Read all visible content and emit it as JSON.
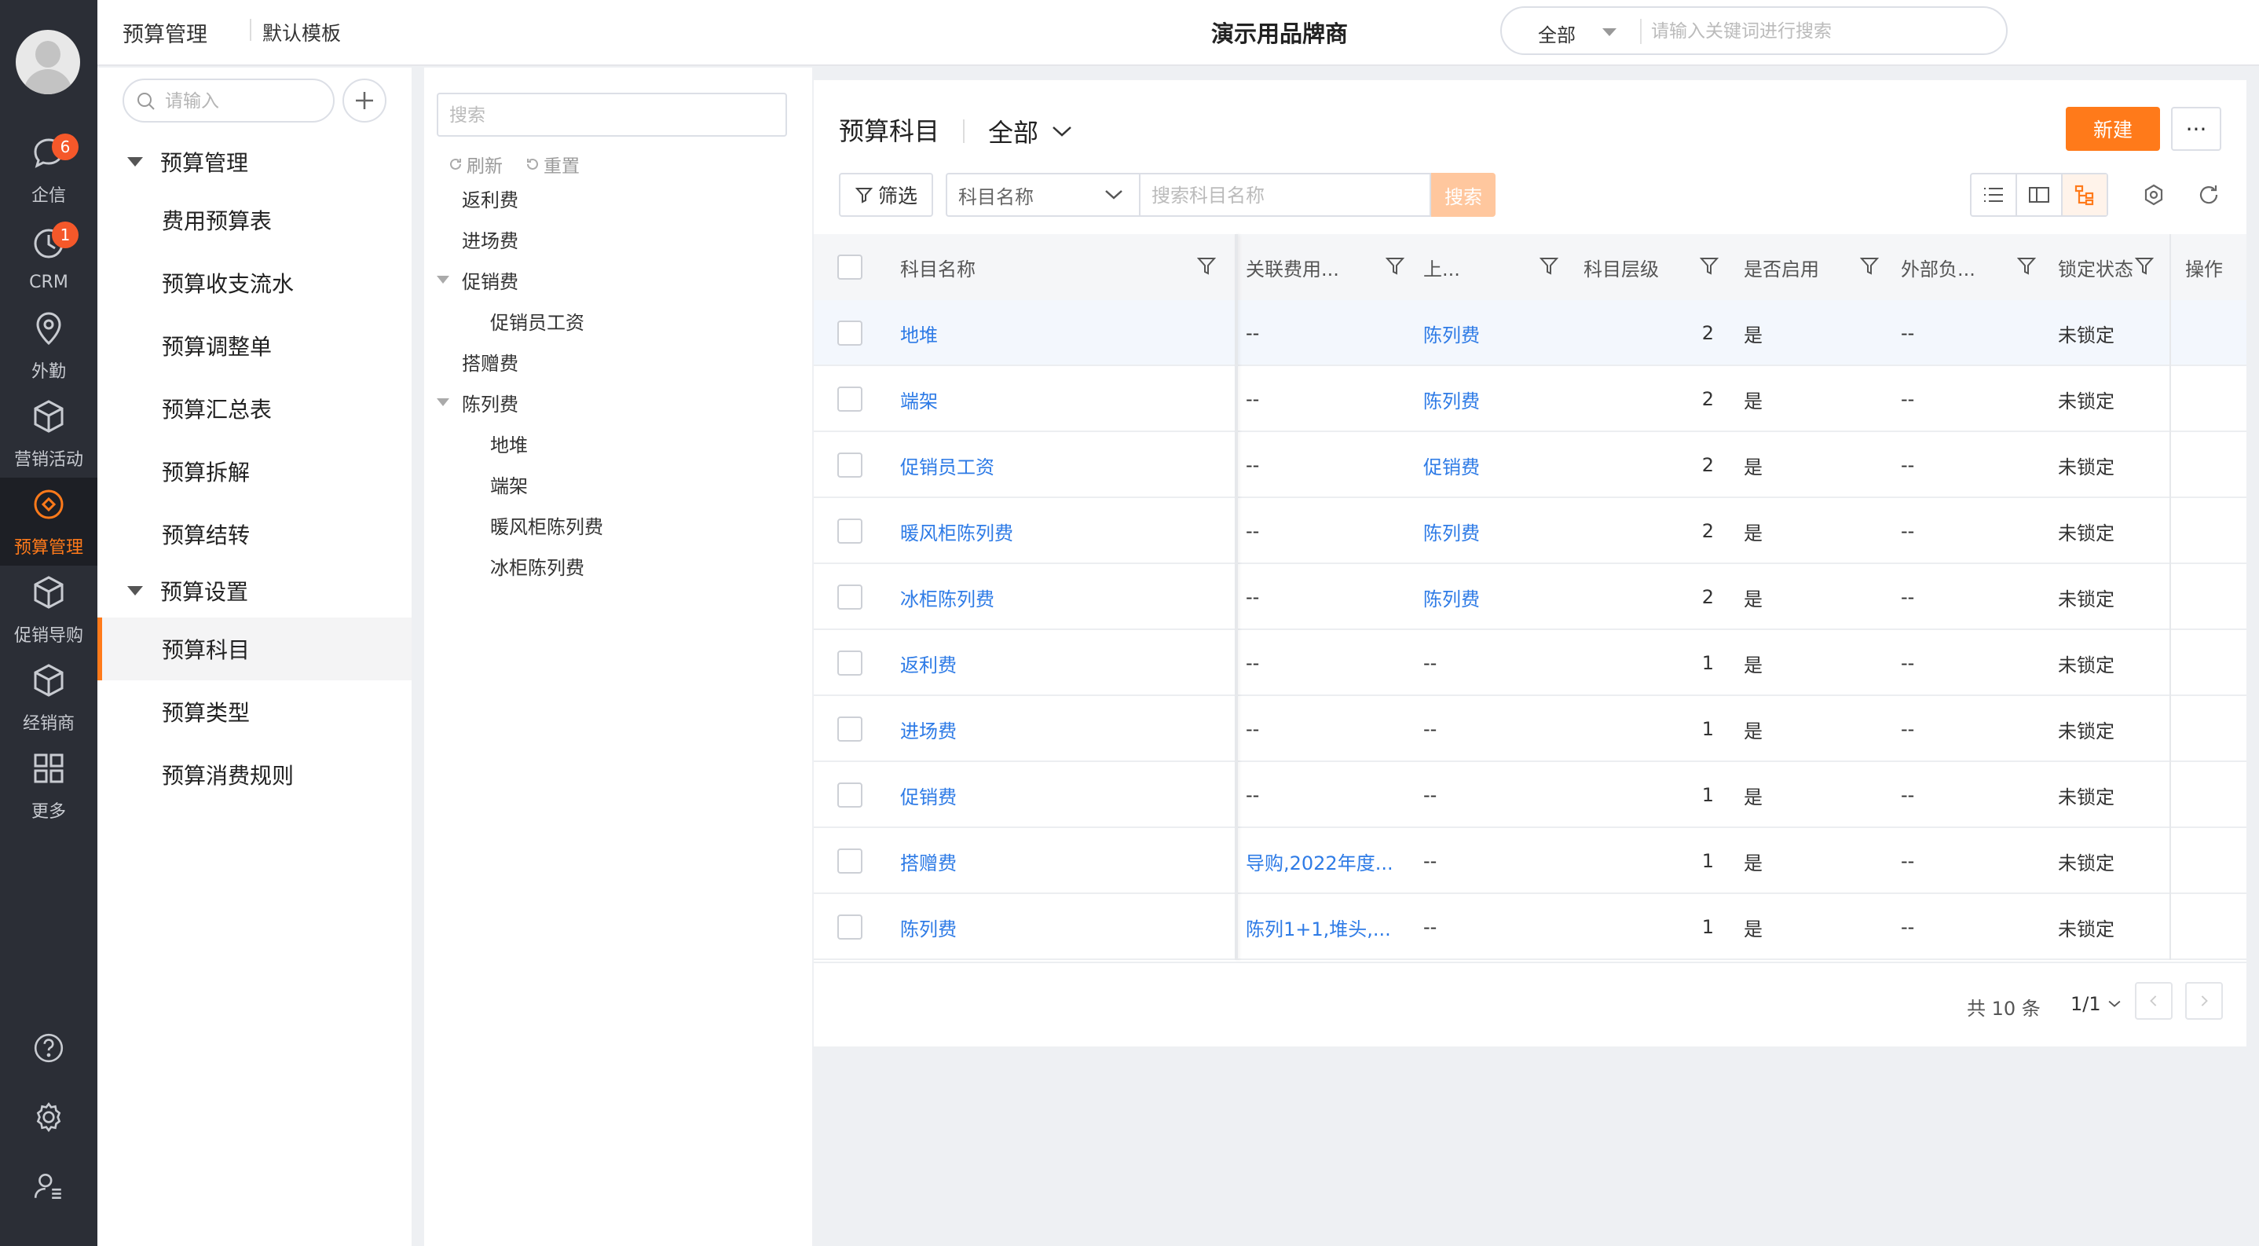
{
  "rail": {
    "items": [
      {
        "label": "企信",
        "badge": "6",
        "icon": "chat-icon"
      },
      {
        "label": "CRM",
        "badge": "1",
        "icon": "clock-icon"
      },
      {
        "label": "外勤",
        "badge": "",
        "icon": "location-icon"
      },
      {
        "label": "营销活动",
        "badge": "",
        "icon": "cube-icon"
      },
      {
        "label": "预算管理",
        "badge": "",
        "icon": "budget-icon"
      },
      {
        "label": "促销导购",
        "badge": "",
        "icon": "cube-icon"
      },
      {
        "label": "经销商",
        "badge": "",
        "icon": "cube-icon"
      },
      {
        "label": "更多",
        "badge": "",
        "icon": "grid-icon"
      }
    ],
    "active_index": 4,
    "accent": "#ff7a1a"
  },
  "topbar": {
    "module": "预算管理",
    "template": "默认模板",
    "brand": "演示用品牌商",
    "search_scope": "全部",
    "search_placeholder": "请输入关键词进行搜索"
  },
  "menu": {
    "search_placeholder": "请输入",
    "groups": [
      {
        "label": "预算管理",
        "items": [
          "费用预算表",
          "预算收支流水",
          "预算调整单",
          "预算汇总表",
          "预算拆解",
          "预算结转"
        ]
      },
      {
        "label": "预算设置",
        "items": [
          "预算科目",
          "预算类型",
          "预算消费规则"
        ]
      }
    ],
    "active_item": "预算科目"
  },
  "tree": {
    "search_placeholder": "搜索",
    "refresh_label": "刷新",
    "reset_label": "重置",
    "nodes": [
      {
        "label": "返利费",
        "level": 0,
        "expanded": false,
        "has_children": false
      },
      {
        "label": "进场费",
        "level": 0,
        "expanded": false,
        "has_children": false
      },
      {
        "label": "促销费",
        "level": 0,
        "expanded": true,
        "has_children": true
      },
      {
        "label": "促销员工资",
        "level": 1,
        "expanded": false,
        "has_children": false
      },
      {
        "label": "搭赠费",
        "level": 0,
        "expanded": false,
        "has_children": false
      },
      {
        "label": "陈列费",
        "level": 0,
        "expanded": true,
        "has_children": true
      },
      {
        "label": "地堆",
        "level": 1,
        "expanded": false,
        "has_children": false
      },
      {
        "label": "端架",
        "level": 1,
        "expanded": false,
        "has_children": false
      },
      {
        "label": "暖风柜陈列费",
        "level": 1,
        "expanded": false,
        "has_children": false
      },
      {
        "label": "冰柜陈列费",
        "level": 1,
        "expanded": false,
        "has_children": false
      }
    ]
  },
  "main": {
    "title": "预算科目",
    "view": "全部",
    "new_label": "新建",
    "more_label": "···",
    "filter_label": "筛选",
    "field_select": "科目名称",
    "keyword_placeholder": "搜索科目名称",
    "search_label": "搜索",
    "columns": [
      "科目名称",
      "关联费用...",
      "上...",
      "科目层级",
      "是否启用",
      "外部负...",
      "锁定状态",
      "操作"
    ],
    "rows": [
      {
        "name": "地堆",
        "related": "--",
        "parent": "陈列费",
        "level": "2",
        "enabled": "是",
        "external": "--",
        "lock": "未锁定"
      },
      {
        "name": "端架",
        "related": "--",
        "parent": "陈列费",
        "level": "2",
        "enabled": "是",
        "external": "--",
        "lock": "未锁定"
      },
      {
        "name": "促销员工资",
        "related": "--",
        "parent": "促销费",
        "level": "2",
        "enabled": "是",
        "external": "--",
        "lock": "未锁定"
      },
      {
        "name": "暖风柜陈列费",
        "related": "--",
        "parent": "陈列费",
        "level": "2",
        "enabled": "是",
        "external": "--",
        "lock": "未锁定"
      },
      {
        "name": "冰柜陈列费",
        "related": "--",
        "parent": "陈列费",
        "level": "2",
        "enabled": "是",
        "external": "--",
        "lock": "未锁定"
      },
      {
        "name": "返利费",
        "related": "--",
        "parent": "--",
        "level": "1",
        "enabled": "是",
        "external": "--",
        "lock": "未锁定"
      },
      {
        "name": "进场费",
        "related": "--",
        "parent": "--",
        "level": "1",
        "enabled": "是",
        "external": "--",
        "lock": "未锁定"
      },
      {
        "name": "促销费",
        "related": "--",
        "parent": "--",
        "level": "1",
        "enabled": "是",
        "external": "--",
        "lock": "未锁定"
      },
      {
        "name": "搭赠费",
        "related": "导购,2022年度...",
        "parent": "--",
        "level": "1",
        "enabled": "是",
        "external": "--",
        "lock": "未锁定"
      },
      {
        "name": "陈列费",
        "related": "陈列1+1,堆头,...",
        "parent": "--",
        "level": "1",
        "enabled": "是",
        "external": "--",
        "lock": "未锁定"
      }
    ],
    "total_label": "共 10 条",
    "page_label": "1/1"
  }
}
